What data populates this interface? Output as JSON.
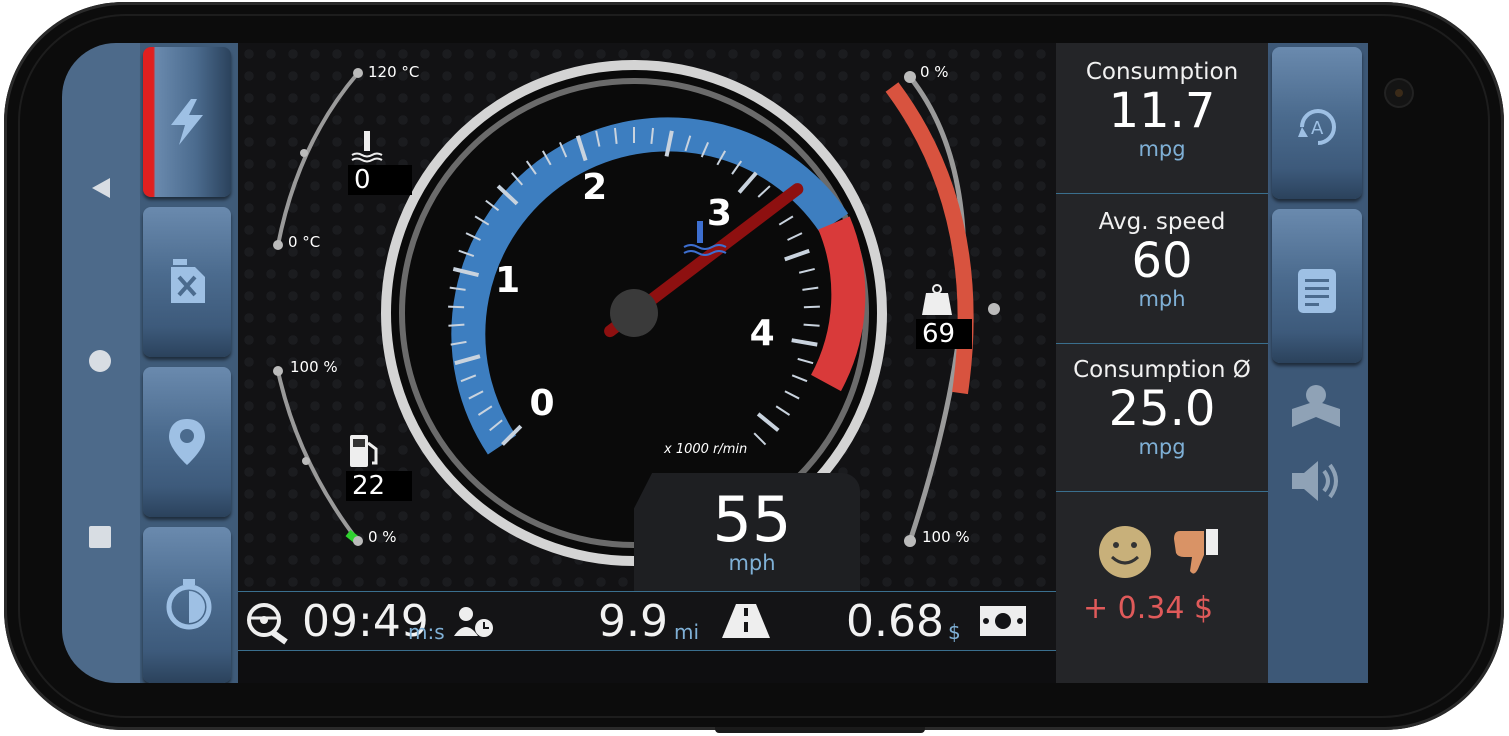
{
  "gauges": {
    "coolant": {
      "max_label": "120 °C",
      "min_label": "0 °C",
      "value": "0",
      "icon": "thermometer-icon"
    },
    "fuel": {
      "max_label": "100 %",
      "min_label": "0 %",
      "value": "22",
      "icon": "fuel-pump-icon",
      "level_pct": 22
    },
    "load": {
      "top_label": "0 %",
      "bottom_label": "100 %",
      "value": "69",
      "icon": "weight-icon",
      "level_pct": 69
    },
    "rpm": {
      "ticks": [
        "0",
        "1",
        "2",
        "3",
        "4"
      ],
      "unit_label": "x 1000 r/min",
      "value_krpm": 3.2
    }
  },
  "speed": {
    "value": "55",
    "unit": "mph"
  },
  "stats": [
    {
      "label": "Consumption",
      "value": "11.7",
      "unit": "mpg"
    },
    {
      "label": "Avg. speed",
      "value": "60",
      "unit": "mph"
    },
    {
      "label": "Consumption Ø",
      "value": "25.0",
      "unit": "mpg"
    }
  ],
  "eco": {
    "delta": "+ 0.34 $",
    "face_icon": "smiley-icon",
    "thumb_icon": "thumbs-down-icon"
  },
  "trip": {
    "time": "09:49",
    "time_unit": "m:s",
    "distance": "9.9",
    "distance_unit": "mi",
    "cost": "0.68",
    "cost_unit": "$"
  },
  "colors": {
    "accent": "#7fb0d6",
    "red": "#e05a5a",
    "rpm_blue": "#3d7ec0",
    "rpm_red": "#d93a3a",
    "fuel_green": "#2fd12f"
  }
}
